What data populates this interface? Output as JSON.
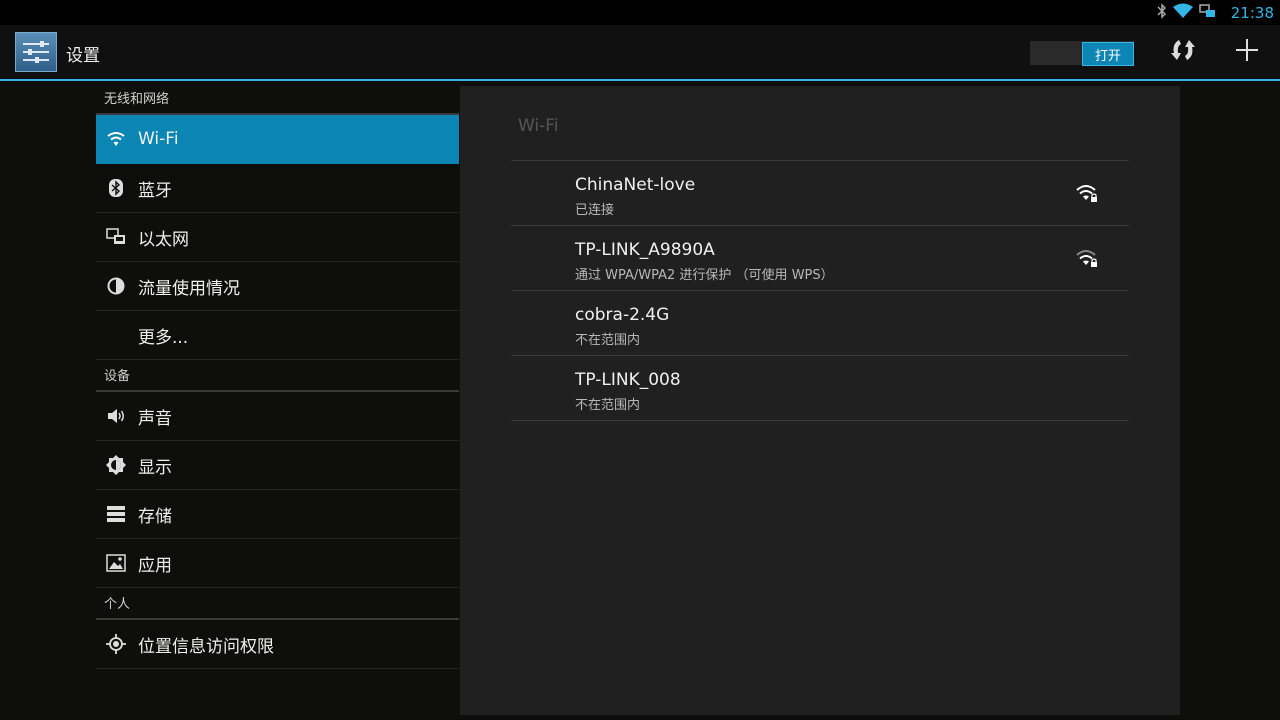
{
  "status_bar": {
    "time": "21:38",
    "icons": [
      "bluetooth-icon",
      "wifi-icon",
      "ethernet-icon"
    ]
  },
  "action_bar": {
    "title": "设置",
    "toggle_label": "打开",
    "icons": [
      "settings-app-icon",
      "refresh-scan-icon",
      "add-icon"
    ]
  },
  "menu": {
    "sections": [
      {
        "header": "无线和网络",
        "items": [
          {
            "label": "Wi-Fi",
            "icon": "wifi-icon",
            "selected": true
          },
          {
            "label": "蓝牙",
            "icon": "bluetooth-icon"
          },
          {
            "label": "以太网",
            "icon": "ethernet-icon"
          },
          {
            "label": "流量使用情况",
            "icon": "data-usage-icon"
          },
          {
            "label": "更多...",
            "icon": ""
          }
        ]
      },
      {
        "header": "设备",
        "items": [
          {
            "label": "声音",
            "icon": "speaker-icon"
          },
          {
            "label": "显示",
            "icon": "brightness-icon"
          },
          {
            "label": "存储",
            "icon": "storage-icon"
          },
          {
            "label": "应用",
            "icon": "apps-icon"
          }
        ]
      },
      {
        "header": "个人",
        "items": [
          {
            "label": "位置信息访问权限",
            "icon": "location-icon"
          }
        ]
      }
    ]
  },
  "wifi_panel": {
    "title": "Wi-Fi",
    "networks": [
      {
        "name": "ChinaNet-love",
        "status": "已连接",
        "signal": "wifi-lock-icon"
      },
      {
        "name": "TP-LINK_A9890A",
        "status": "通过 WPA/WPA2 进行保护 （可使用 WPS）",
        "signal": "wifi-lock-icon"
      },
      {
        "name": "cobra-2.4G",
        "status": "不在范围内",
        "signal": ""
      },
      {
        "name": "TP-LINK_008",
        "status": "不在范围内",
        "signal": ""
      }
    ]
  },
  "colors": {
    "accent": "#33b5e5",
    "selected_bg": "#0a85b4",
    "panel_bg": "#202020",
    "page_bg": "#0e0e0c"
  }
}
